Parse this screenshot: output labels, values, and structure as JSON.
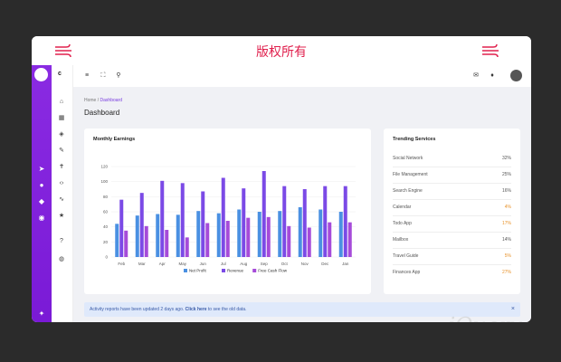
{
  "banner": {
    "title": "版权所有"
  },
  "sidebar": {
    "brand": "c"
  },
  "breadcrumb": {
    "home": "Home",
    "separator": "/",
    "current": "Dashboard"
  },
  "page": {
    "title": "Dashboard"
  },
  "earnings": {
    "title": "Monthly Earnings"
  },
  "trending": {
    "title": "Trending Services",
    "items": [
      {
        "name": "Social Network",
        "value": "32%",
        "color": "#555555"
      },
      {
        "name": "File Management",
        "value": "25%",
        "color": "#555555"
      },
      {
        "name": "Search Engine",
        "value": "16%",
        "color": "#555555"
      },
      {
        "name": "Calendar",
        "value": "4%",
        "color": "#e8922a"
      },
      {
        "name": "Todo App",
        "value": "17%",
        "color": "#e8922a"
      },
      {
        "name": "Mailbox",
        "value": "14%",
        "color": "#555555"
      },
      {
        "name": "Travel Guide",
        "value": "5%",
        "color": "#e8922a"
      },
      {
        "name": "Finances App",
        "value": "27%",
        "color": "#e8922a"
      }
    ]
  },
  "alert": {
    "text": "Activity reports have been updated 2 days ago. ",
    "link": "Click here",
    "suffix": " to see the old data.",
    "close": "×"
  },
  "colors": {
    "accent": "#7a1ad6",
    "net_profit": "#4a90e2",
    "revenue": "#7b4ae6",
    "free_cash_flow": "#a64bd9"
  },
  "chart_data": {
    "type": "bar",
    "title": "Monthly Earnings",
    "categories": [
      "Feb",
      "Mar",
      "Apr",
      "May",
      "Jun",
      "Jul",
      "Aug",
      "Sep",
      "Oct",
      "Nov",
      "Dec",
      "Jan"
    ],
    "series": [
      {
        "name": "Net Profit",
        "color": "#4a90e2",
        "values": [
          44,
          55,
          57,
          56,
          61,
          58,
          63,
          60,
          61,
          66,
          63,
          60
        ]
      },
      {
        "name": "Revenue",
        "color": "#7b4ae6",
        "values": [
          76,
          85,
          101,
          98,
          87,
          105,
          91,
          114,
          94,
          90,
          94,
          94
        ]
      },
      {
        "name": "Free Cash Flow",
        "color": "#a64bd9",
        "values": [
          35,
          41,
          36,
          26,
          45,
          48,
          52,
          53,
          41,
          39,
          46,
          46
        ]
      }
    ],
    "yticks": [
      "0",
      "20",
      "40",
      "60",
      "80",
      "100",
      "120"
    ],
    "ylim": [
      0,
      120
    ],
    "grid": true,
    "legend": "bottom"
  }
}
